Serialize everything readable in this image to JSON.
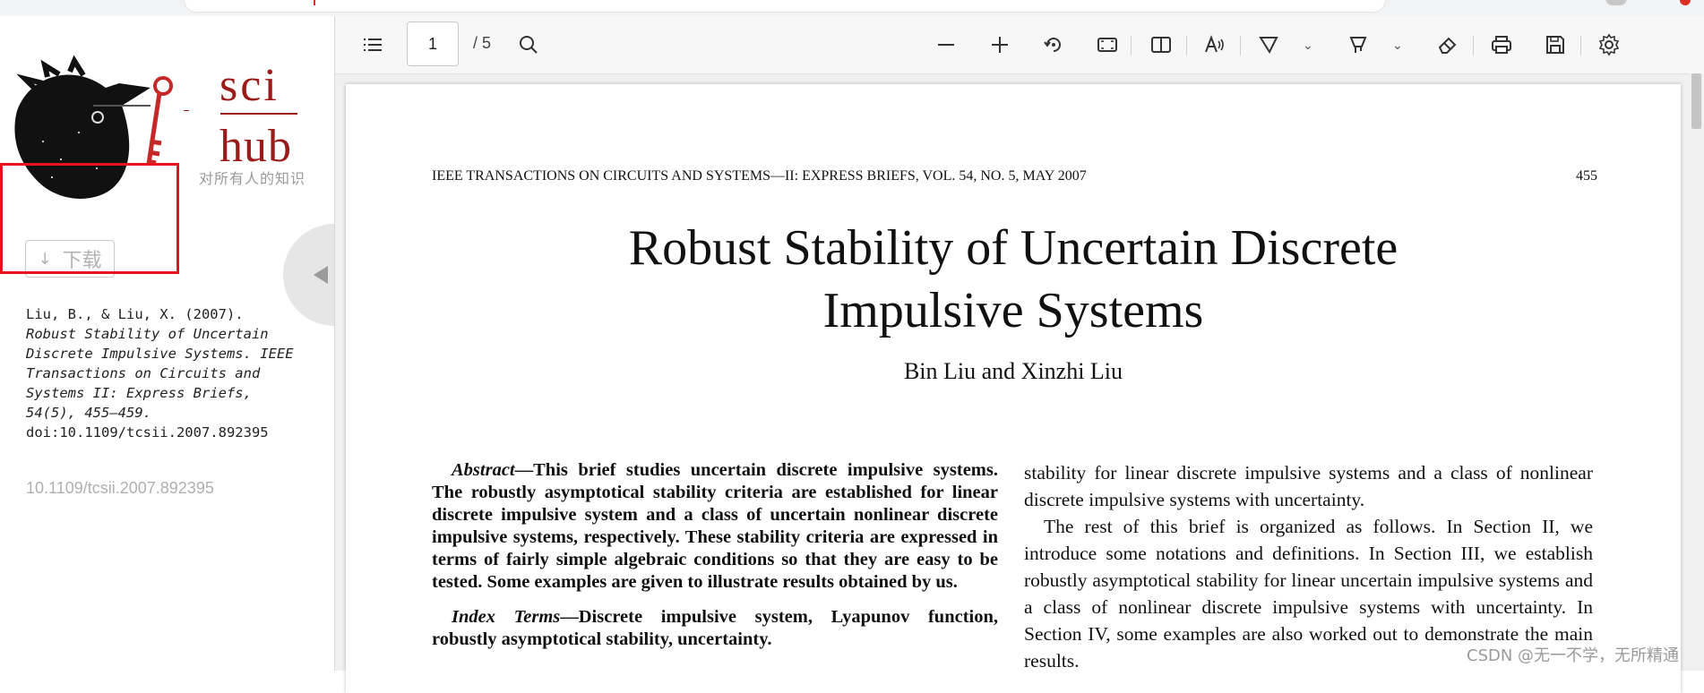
{
  "left_panel": {
    "logo_word_top": "sci",
    "logo_word_bottom": "hub",
    "slogan": "对所有人的知识",
    "download_label": "下载",
    "citation": {
      "authors_year": "Liu, B., & Liu, X. (2007).",
      "title_journal": "Robust Stability of Uncertain Discrete Impulsive Systems. IEEE Transactions on Circuits and Systems II: Express Briefs, 54(5), 455–459.",
      "doi_line": "doi:10.1109/tcsii.2007.892395"
    },
    "doi_link": "10.1109/tcsii.2007.892395"
  },
  "toolbar": {
    "page_current": "1",
    "page_total": "/ 5"
  },
  "document": {
    "running_head": "IEEE TRANSACTIONS ON CIRCUITS AND SYSTEMS—II: EXPRESS BRIEFS, VOL. 54, NO. 5, MAY 2007",
    "page_number": "455",
    "title_line1": "Robust Stability of Uncertain Discrete",
    "title_line2": "Impulsive Systems",
    "authors": "Bin Liu and Xinzhi Liu",
    "abstract_lead": "Abstract",
    "abstract_body": "—This brief studies uncertain discrete impulsive systems. The robustly asymptotical stability criteria are established for linear discrete impulsive system and a class of uncertain nonlinear discrete impulsive systems, respectively. These stability criteria are expressed in terms of fairly simple algebraic conditions so that they are easy to be tested. Some examples are given to illustrate results obtained by us.",
    "index_lead": "Index Terms",
    "index_body": "—Discrete impulsive system, Lyapunov function, robustly asymptotical stability, uncertainty.",
    "right_p1": "stability for linear discrete impulsive systems and a class of nonlinear discrete impulsive systems with uncertainty.",
    "right_p2": "The rest of this brief is organized as follows. In Section II, we introduce some notations and definitions. In Section III, we establish robustly asymptotical stability for linear uncertain impulsive systems and a class of nonlinear discrete impulsive systems with uncertainty. In Section IV, some examples are also worked out to demonstrate the main results."
  },
  "watermark": "CSDN @无一不学，无所精通",
  "colors": {
    "brand_red": "#9b1b1b",
    "highlight_box": "#e8131b"
  }
}
